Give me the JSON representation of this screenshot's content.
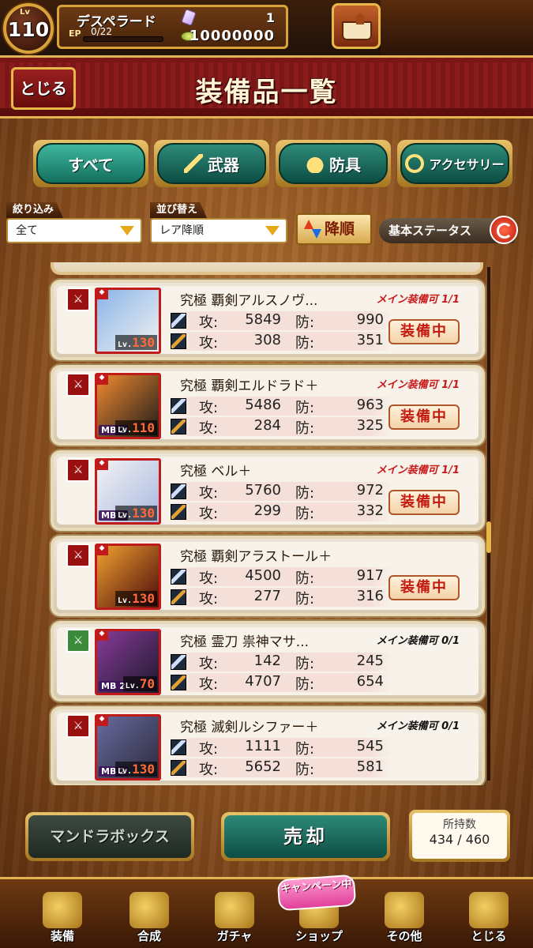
{
  "player": {
    "lv_label": "Lv",
    "level": "110",
    "name": "デスペラード",
    "ep_label": "EP",
    "ep_text": "0/22",
    "gems": "1",
    "coins": "10000000"
  },
  "header": {
    "close_label": "とじる",
    "title": "装備品一覧"
  },
  "tabs": [
    {
      "label": "すべて",
      "active": true
    },
    {
      "label": "武器"
    },
    {
      "label": "防具"
    },
    {
      "label": "アクセサリー"
    }
  ],
  "filter": {
    "filter_label": "絞り込み",
    "filter_value": "全て",
    "sort_label": "並び替え",
    "sort_value": "レア降順",
    "order_label": "降順",
    "basic_status_label": "基本ステータス"
  },
  "stat_labels": {
    "atk": "攻:",
    "def": "防:"
  },
  "items": [
    {
      "name": "究極 覇剣アルスノヴ...",
      "limit": "メイン装備可 1/1",
      "mb": "",
      "lv": "130",
      "atk1": "5849",
      "def1": "990",
      "atk2": "308",
      "def2": "351",
      "equipped": "装備中"
    },
    {
      "name": "究極 覇剣エルドラド＋",
      "limit": "メイン装備可 1/1",
      "mb": "MB 2",
      "lv": "110",
      "atk1": "5486",
      "def1": "963",
      "atk2": "284",
      "def2": "325",
      "equipped": "装備中"
    },
    {
      "name": "究極 ベル＋",
      "limit": "メイン装備可 1/1",
      "mb": "MB 2",
      "lv": "130",
      "atk1": "5760",
      "def1": "972",
      "atk2": "299",
      "def2": "332",
      "equipped": "装備中"
    },
    {
      "name": "究極 覇剣アラストール＋",
      "limit": "",
      "mb": "",
      "lv": "130",
      "atk1": "4500",
      "def1": "917",
      "atk2": "277",
      "def2": "316",
      "equipped": "装備中"
    },
    {
      "name": "究極 霊刀 祟神マサ...",
      "limit": "メイン装備可 0/1",
      "mb": "MB 2",
      "lv": "70",
      "atk1": "142",
      "def1": "245",
      "atk2": "4707",
      "def2": "654",
      "equipped": ""
    },
    {
      "name": "究極 滅剣ルシファー＋",
      "limit": "メイン装備可 0/1",
      "mb": "MB 2",
      "lv": "130",
      "atk1": "1111",
      "def1": "545",
      "atk2": "5652",
      "def2": "581",
      "equipped": ""
    }
  ],
  "actions": {
    "mandra_label": "マンドラボックス",
    "sell_label": "売却",
    "owned_label": "所持数",
    "owned_value": "434 / 460"
  },
  "nav": [
    {
      "label": "装備",
      "icon": "equip-icon"
    },
    {
      "label": "合成",
      "icon": "hammer-icon"
    },
    {
      "label": "ガチャ",
      "icon": "gacha-icon"
    },
    {
      "label": "ショップ",
      "icon": "shop-icon"
    },
    {
      "label": "その他",
      "icon": "gear-icon"
    },
    {
      "label": "とじる",
      "icon": "close-icon"
    }
  ],
  "campaign_label": "キャンペーン中",
  "colors": {
    "accent_gold": "#e3b352",
    "header_red": "#7c1616",
    "tab_green": "#2e8a78",
    "equipped_red": "#c41a10"
  }
}
